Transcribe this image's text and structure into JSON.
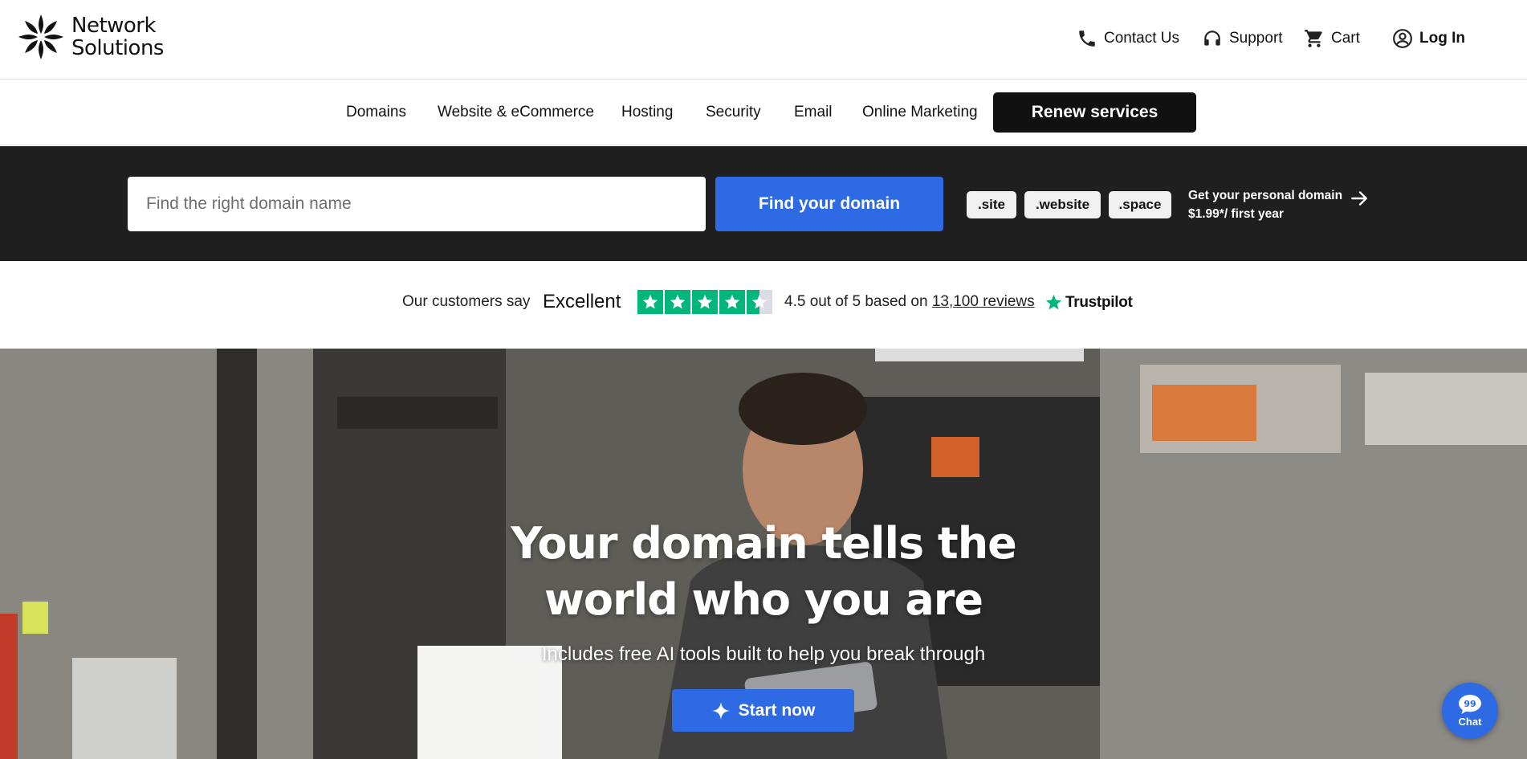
{
  "brand": {
    "name_line1": "Network",
    "name_line2": "Solutions"
  },
  "utility_nav": {
    "contact": "Contact Us",
    "support": "Support",
    "cart": "Cart",
    "login": "Log In"
  },
  "main_nav": {
    "items": [
      "Domains",
      "Website & eCommerce",
      "Hosting",
      "Security",
      "Email",
      "Online Marketing"
    ],
    "cta": "Renew services"
  },
  "search": {
    "placeholder": "Find the right domain name",
    "value": "",
    "button": "Find your domain",
    "tlds": [
      ".site",
      ".website",
      ".space"
    ],
    "promo_line1": "Get your personal domain",
    "promo_line2": "$1.99*/ first year"
  },
  "trustpilot": {
    "prefix": "Our customers say",
    "verdict": "Excellent",
    "stars": 4.5,
    "rating_text": "4.5 out of 5 based on",
    "reviews_link": "13,100 reviews",
    "brand": "Trustpilot"
  },
  "hero": {
    "title": "Your domain tells the world who you are",
    "subtitle": "Includes free AI tools built to help you break through",
    "cta": "Start now"
  },
  "chat": {
    "label": "Chat"
  },
  "colors": {
    "accent_blue": "#2d6ae3",
    "dark_band": "#1f1f1f",
    "trustpilot_green": "#00b67a"
  }
}
